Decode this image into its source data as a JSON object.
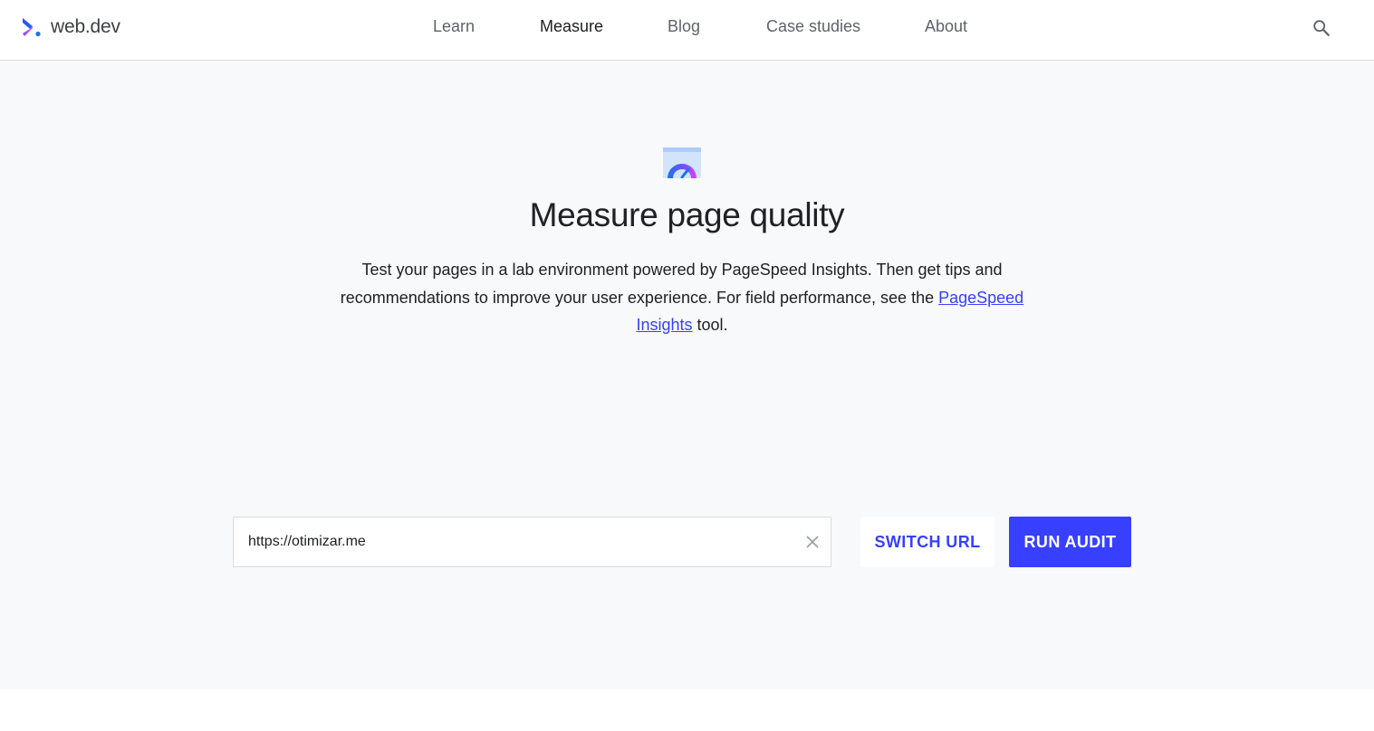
{
  "header": {
    "brand_name": "web.dev",
    "nav": [
      {
        "label": "Learn",
        "active": false
      },
      {
        "label": "Measure",
        "active": true
      },
      {
        "label": "Blog",
        "active": false
      },
      {
        "label": "Case studies",
        "active": false
      },
      {
        "label": "About",
        "active": false
      }
    ],
    "search_icon": "search-icon"
  },
  "hero": {
    "icon": "gauge-icon",
    "title": "Measure page quality",
    "description_before": "Test your pages in a lab environment powered by PageSpeed Insights. Then get tips and recommendations to improve your user experience. For field performance, see the ",
    "description_link": "PageSpeed Insights",
    "description_after": " tool."
  },
  "form": {
    "url_value": "https://otimizar.me",
    "clear_icon": "close-icon",
    "switch_label": "SWITCH URL",
    "run_label": "RUN AUDIT"
  },
  "colors": {
    "accent": "#3740ff",
    "page_background": "#f8f9fa",
    "header_background": "#ffffff"
  }
}
